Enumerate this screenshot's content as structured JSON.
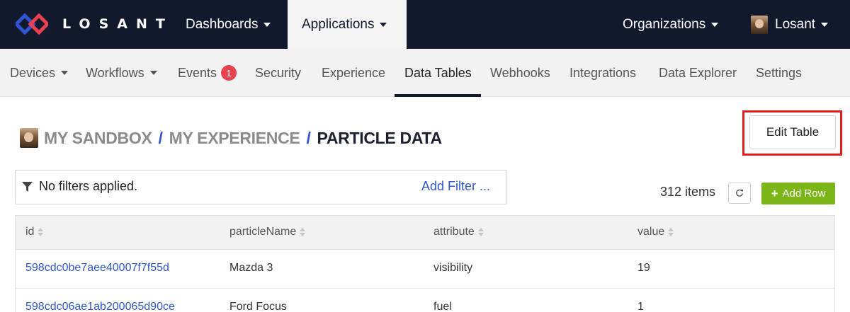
{
  "brand": {
    "name": "LOSANT"
  },
  "topnav": {
    "dashboards": "Dashboards",
    "applications": "Applications",
    "organizations": "Organizations",
    "user": "Losant"
  },
  "subnav": {
    "items": [
      {
        "label": "Devices"
      },
      {
        "label": "Workflows"
      },
      {
        "label": "Events",
        "badge": "1"
      },
      {
        "label": "Security"
      },
      {
        "label": "Experience"
      },
      {
        "label": "Data Tables"
      },
      {
        "label": "Webhooks"
      },
      {
        "label": "Integrations"
      },
      {
        "label": "Data Explorer"
      },
      {
        "label": "Settings"
      }
    ]
  },
  "breadcrumb": {
    "sandbox": "MY SANDBOX",
    "experience": "MY EXPERIENCE",
    "current": "PARTICLE DATA",
    "separator": "/"
  },
  "actions": {
    "edit_table": "Edit Table",
    "add_row": "Add Row",
    "items_count": "312 items"
  },
  "filter": {
    "status": "No filters applied.",
    "add": "Add Filter ..."
  },
  "table": {
    "columns": [
      "id",
      "particleName",
      "attribute",
      "value"
    ],
    "rows": [
      [
        "598cdc0be7aee40007f7f55d",
        "Mazda 3",
        "visibility",
        "19"
      ],
      [
        "598cdc06ae1ab200065d90ce",
        "Ford Focus",
        "fuel",
        "1"
      ]
    ]
  },
  "colors": {
    "navbar": "#13192d",
    "accent_blue": "#2f55d4",
    "add_green": "#7cb518",
    "badge_red": "#e8414f",
    "highlight_red": "#e01c1c"
  }
}
